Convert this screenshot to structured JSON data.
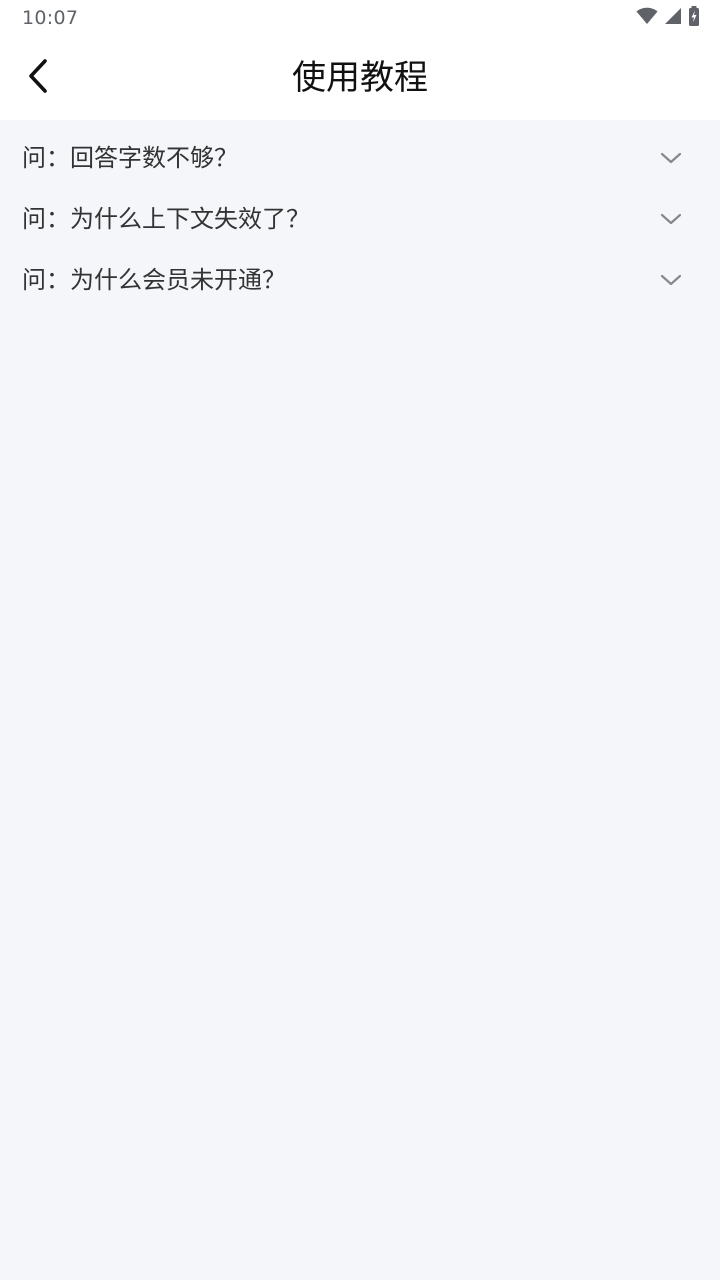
{
  "status_bar": {
    "time": "10:07",
    "icons": [
      "wifi-icon",
      "signal-icon",
      "battery-charging-icon"
    ]
  },
  "header": {
    "title": "使用教程",
    "back_icon": "chevron-left-icon"
  },
  "faq": {
    "items": [
      {
        "question": "问：回答字数不够？",
        "icon": "chevron-down-icon"
      },
      {
        "question": "问：为什么上下文失效了？",
        "icon": "chevron-down-icon"
      },
      {
        "question": "问：为什么会员未开通？",
        "icon": "chevron-down-icon"
      }
    ]
  },
  "colors": {
    "background": "#f4f6fa",
    "bar_background": "#ffffff",
    "title_text": "#111111",
    "question_text": "#333333",
    "chevron": "#888888"
  }
}
